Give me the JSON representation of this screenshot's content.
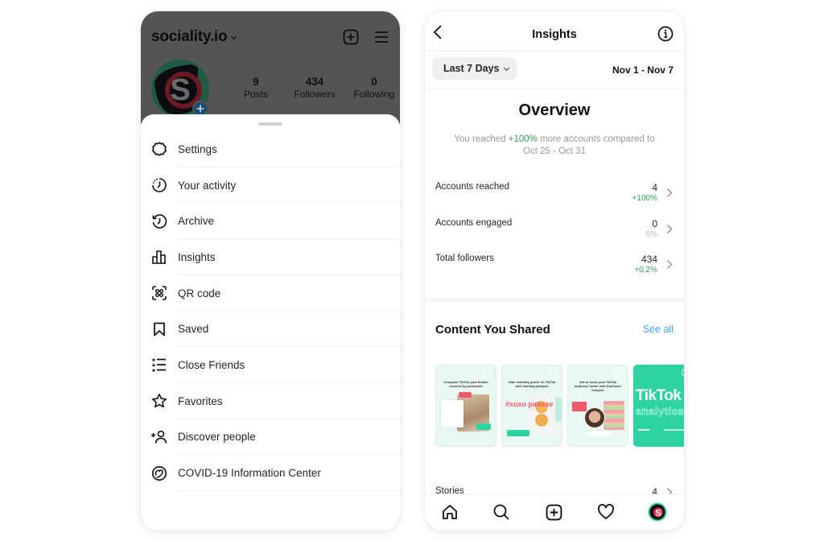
{
  "left_phone": {
    "profile": {
      "username": "sociality.io",
      "stats": [
        {
          "value": "9",
          "label": "Posts"
        },
        {
          "value": "434",
          "label": "Followers"
        },
        {
          "value": "0",
          "label": "Following"
        }
      ],
      "icons": {
        "username_dropdown": "chevron-down-icon",
        "new_post": "plus-square-icon",
        "menu": "hamburger-menu-icon",
        "add_story": "plus-circle-icon"
      }
    },
    "menu": [
      {
        "label": "Settings",
        "icon": "settings-icon"
      },
      {
        "label": "Your activity",
        "icon": "activity-icon"
      },
      {
        "label": "Archive",
        "icon": "archive-icon"
      },
      {
        "label": "Insights",
        "icon": "insights-icon"
      },
      {
        "label": "QR code",
        "icon": "qr-code-icon"
      },
      {
        "label": "Saved",
        "icon": "bookmark-icon"
      },
      {
        "label": "Close Friends",
        "icon": "close-friends-icon"
      },
      {
        "label": "Favorites",
        "icon": "star-icon"
      },
      {
        "label": "Discover people",
        "icon": "add-person-icon"
      },
      {
        "label": "COVID-19 Information Center",
        "icon": "covid-info-icon"
      }
    ]
  },
  "right_phone": {
    "header": {
      "title": "Insights",
      "back_icon": "chevron-left-icon",
      "info_icon": "info-icon"
    },
    "range": {
      "selected": "Last 7 Days",
      "dates": "Nov 1 - Nov 7"
    },
    "overview": {
      "title": "Overview",
      "sub_prefix": "You reached ",
      "sub_highlight": "+100%",
      "sub_suffix": " more accounts compared to",
      "sub_compare": "Oct 25 - Oct 31"
    },
    "metrics": [
      {
        "label": "Accounts reached",
        "value": "4",
        "delta": "+100%",
        "trend": "positive"
      },
      {
        "label": "Accounts engaged",
        "value": "0",
        "delta": "0%",
        "trend": "neutral"
      },
      {
        "label": "Total followers",
        "value": "434",
        "delta": "+0.2%",
        "trend": "positive"
      }
    ],
    "content": {
      "title": "Content You Shared",
      "see_all": "See all",
      "thumbnails": [
        {
          "caption": "Complete TikTok post details covered by postcards",
          "style": "light"
        },
        {
          "caption": "Gain visibility power on TikTok with hashtag analysis",
          "hashtag": "#xuxo patisse",
          "style": "light"
        },
        {
          "caption": "Get to know your TikTok audience better with Audience Insights",
          "style": "light"
        },
        {
          "title": "TikTok",
          "subtitle": "analytics",
          "style": "brand"
        }
      ]
    },
    "stories": {
      "label": "Stories",
      "value": "4"
    },
    "tabbar": [
      {
        "name": "home",
        "icon": "home-icon"
      },
      {
        "name": "search",
        "icon": "search-icon"
      },
      {
        "name": "new-post",
        "icon": "plus-square-icon"
      },
      {
        "name": "activity",
        "icon": "heart-icon"
      },
      {
        "name": "profile",
        "icon": "profile-avatar-icon"
      }
    ]
  },
  "colors": {
    "positive": "#37a354",
    "neutral": "#bdbdbd",
    "link": "#3ea6f5",
    "brand_green": "#2ed4a0",
    "brand_red": "#e0334c",
    "overlay": "#545454"
  }
}
